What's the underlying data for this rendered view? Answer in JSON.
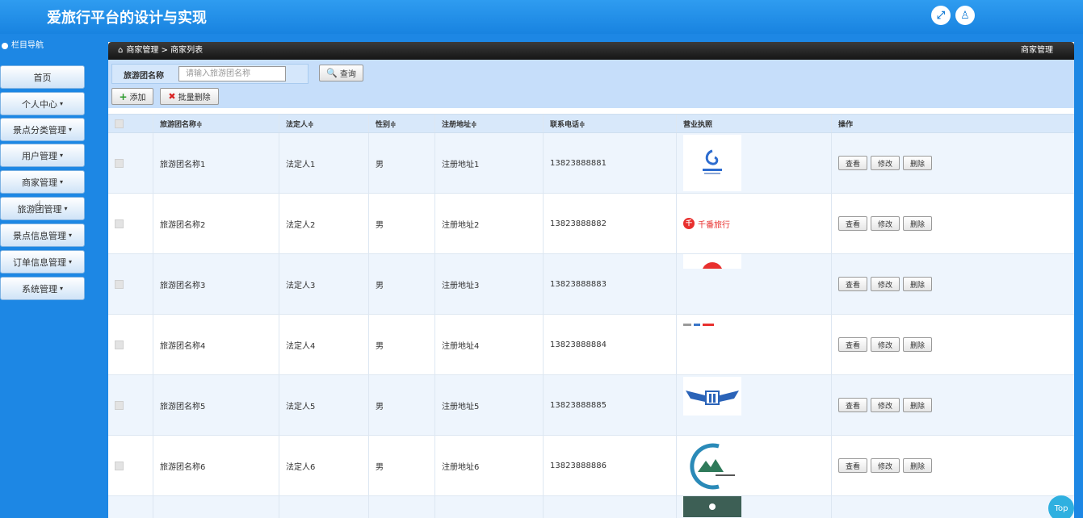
{
  "app": {
    "title": "爱旅行平台的设计与实现"
  },
  "header_icons": {
    "fullscreen": "⤢",
    "user": "♙"
  },
  "sidebar": {
    "title": "栏目导航",
    "items": [
      {
        "label": "首页",
        "caret": ""
      },
      {
        "label": "个人中心",
        "caret": "▾"
      },
      {
        "label": "景点分类管理",
        "caret": "▾"
      },
      {
        "label": "用户管理",
        "caret": "▾"
      },
      {
        "label": "商家管理",
        "caret": "▾"
      },
      {
        "label": "旅游团管理",
        "caret": "▾"
      },
      {
        "label": "景点信息管理",
        "caret": "▾"
      },
      {
        "label": "订单信息管理",
        "caret": "▾"
      },
      {
        "label": "系统管理",
        "caret": "▾"
      }
    ]
  },
  "titlebar": {
    "home_icon": "⌂",
    "breadcrumb": "商家管理 > 商家列表",
    "right": "商家管理"
  },
  "search": {
    "label": "旅游团名称",
    "placeholder": "请输入旅游团名称",
    "button": "查询"
  },
  "toolbar": {
    "add": "添加",
    "batch_delete": "批量删除"
  },
  "table": {
    "columns": [
      "旅游团名称≑",
      "法定人≑",
      "性别≑",
      "注册地址≑",
      "联系电话≑",
      "营业执照",
      "操作"
    ],
    "rows": [
      {
        "name": "旅游团名称1",
        "legal": "法定人1",
        "gender": "男",
        "address": "注册地址1",
        "phone": "13823888881",
        "logo": "travel-agency-logo"
      },
      {
        "name": "旅游团名称2",
        "legal": "法定人2",
        "gender": "男",
        "address": "注册地址2",
        "phone": "13823888882",
        "logo": "qianfan-logo",
        "logo_text": "千番旅行"
      },
      {
        "name": "旅游团名称3",
        "legal": "法定人3",
        "gender": "男",
        "address": "注册地址3",
        "phone": "13823888883",
        "logo": "red-circle-logo"
      },
      {
        "name": "旅游团名称4",
        "legal": "法定人4",
        "gender": "男",
        "address": "注册地址4",
        "phone": "13823888884",
        "logo": "small-logo"
      },
      {
        "name": "旅游团名称5",
        "legal": "法定人5",
        "gender": "男",
        "address": "注册地址5",
        "phone": "13823888885",
        "logo": "wings-logo"
      },
      {
        "name": "旅游团名称6",
        "legal": "法定人6",
        "gender": "男",
        "address": "注册地址6",
        "phone": "13823888886",
        "logo": "c-mountain-logo"
      }
    ],
    "actions": {
      "view": "查看",
      "edit": "修改",
      "delete": "删除"
    }
  },
  "top_button": "Top",
  "colors": {
    "header": "#1e8ae6",
    "sidebar": "#1d87e4",
    "search_bg": "#c6defa",
    "accent": "#2fb0e0"
  }
}
